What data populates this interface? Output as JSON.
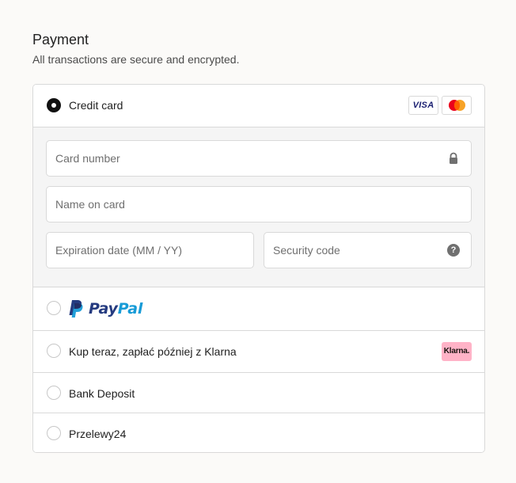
{
  "payment": {
    "title": "Payment",
    "subtitle": "All transactions are secure and encrypted."
  },
  "methods": {
    "credit_card": {
      "label": "Credit card",
      "selected": true,
      "logos": {
        "visa": "VISA",
        "mastercard_icon": "mastercard-icon"
      },
      "fields": {
        "card_number": {
          "placeholder": "Card number",
          "value": "",
          "icon": "lock-icon"
        },
        "name_on_card": {
          "placeholder": "Name on card",
          "value": ""
        },
        "expiration": {
          "placeholder": "Expiration date (MM / YY)",
          "value": ""
        },
        "security_code": {
          "placeholder": "Security code",
          "value": "",
          "icon": "help-icon",
          "icon_glyph": "?"
        }
      }
    },
    "paypal": {
      "selected": false,
      "logo_text_pay": "Pay",
      "logo_text_pal": "Pal"
    },
    "klarna": {
      "label": "Kup teraz, zapłać później z Klarna",
      "selected": false,
      "badge": "Klarna."
    },
    "bank_deposit": {
      "label": "Bank Deposit",
      "selected": false
    },
    "przelewy24": {
      "label": "Przelewy24",
      "selected": false
    }
  },
  "colors": {
    "background": "#fbfaf8",
    "border": "#d9d9d9",
    "panel": "#f5f5f5",
    "paypal_dark": "#253b80",
    "paypal_light": "#179bd7",
    "klarna_pink": "#ffb3c7",
    "visa_blue": "#1a1f71"
  }
}
